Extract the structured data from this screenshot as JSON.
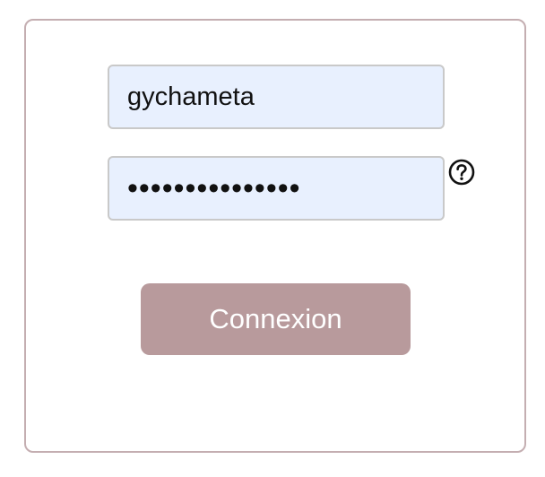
{
  "login_form": {
    "username_value": "gychameta",
    "password_value": "•••••••••••••••",
    "help_icon": "question-circle-icon",
    "submit_label": "Connexion"
  },
  "colors": {
    "card_border": "#c4aeb1",
    "input_background": "#e8f0fe",
    "button_background": "#b89a9c",
    "button_text": "#ffffff"
  }
}
